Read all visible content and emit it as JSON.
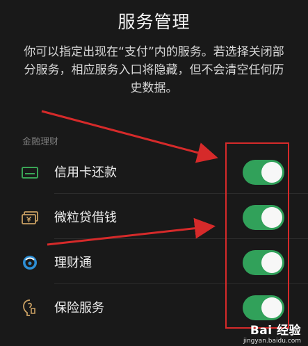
{
  "header": {
    "title": "服务管理",
    "description": "你可以指定出现在“支付”内的服务。若选择关闭部分服务，相应服务入口将隐藏，但不会清空任何历史数据。"
  },
  "section": {
    "label": "金融理财",
    "items": [
      {
        "label": "信用卡还款",
        "icon": "credit-card-icon",
        "enabled": true
      },
      {
        "label": "微粒贷借钱",
        "icon": "loan-money-icon",
        "enabled": true
      },
      {
        "label": "理财通",
        "icon": "wealth-management-icon",
        "enabled": true
      },
      {
        "label": "保险服务",
        "icon": "insurance-icon",
        "enabled": true
      }
    ]
  },
  "watermark": {
    "main": "Bai 经验",
    "sub": "jingyan.baidu.com"
  },
  "colors": {
    "background": "#191919",
    "toggle_on": "#31a15a",
    "annotation_red": "#d62a2a",
    "credit_icon": "#3aa556",
    "loan_icon": "#c9a063",
    "wealth_icon": "#2d8fd6",
    "insurance_icon": "#c9a063"
  }
}
